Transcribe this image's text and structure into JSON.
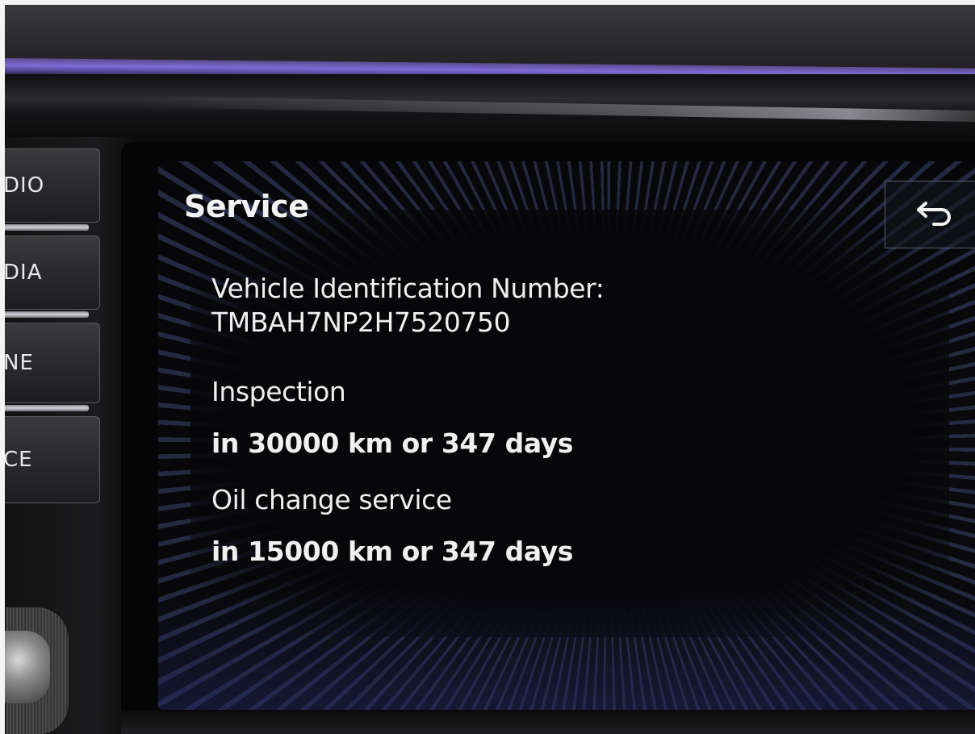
{
  "hardware_buttons": [
    {
      "label": "DIO"
    },
    {
      "label": "DIA"
    },
    {
      "label": "NE"
    },
    {
      "label": "CE"
    }
  ],
  "screen": {
    "title": "Service",
    "back_icon": "back-arrow-icon",
    "vin_label": "Vehicle Identification Number:",
    "vin_value": "TMBAH7NP2H7520750",
    "inspection_label": "Inspection",
    "inspection_due": "in 30000 km or 347 days",
    "oil_label": "Oil change service",
    "oil_due": "in 15000 km or 347 days"
  },
  "colors": {
    "text": "#f0f0f0",
    "background": "#08080a",
    "ambient_light": "#7d6cd6",
    "ray_accent": "#465082"
  }
}
